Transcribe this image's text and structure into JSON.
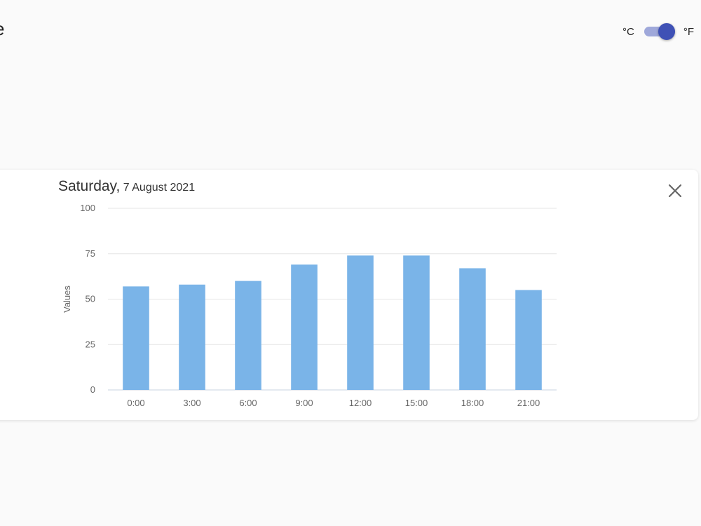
{
  "header": {
    "title": "e"
  },
  "unit_toggle": {
    "celsius_label": "°C",
    "fahrenheit_label": "°F",
    "selected": "°F"
  },
  "card": {
    "day": "Saturday,",
    "date": "7 August 2021",
    "close_icon": "close-icon"
  },
  "colors": {
    "bar": "#7ab4e8",
    "toggle_thumb": "#3f51b5",
    "toggle_track": "#9fa8da",
    "grid": "#e6e6e6"
  },
  "chart_data": {
    "type": "bar",
    "categories": [
      "0:00",
      "3:00",
      "6:00",
      "9:00",
      "12:00",
      "15:00",
      "18:00",
      "21:00"
    ],
    "values": [
      57,
      58,
      60,
      69,
      74,
      74,
      67,
      55
    ],
    "title": "",
    "xlabel": "",
    "ylabel": "Values",
    "ylim": [
      0,
      100
    ],
    "yticks": [
      0,
      25,
      50,
      75,
      100
    ],
    "grid": true,
    "legend": "none"
  }
}
